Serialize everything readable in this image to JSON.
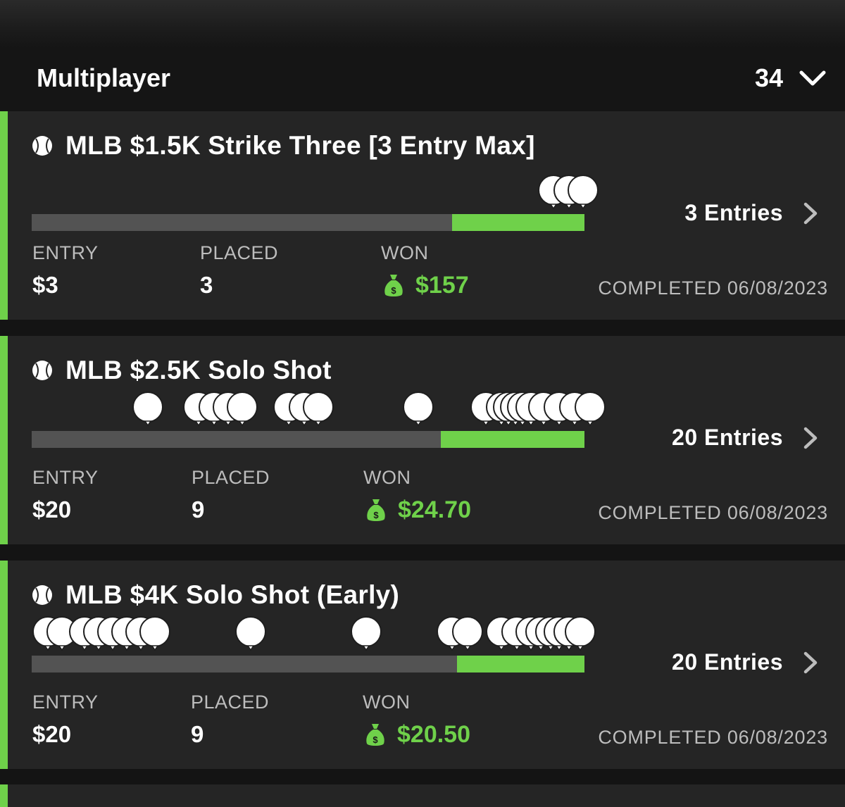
{
  "section": {
    "title": "Multiplayer",
    "count": "34"
  },
  "colors": {
    "accent": "#6fd14a",
    "background": "#141414",
    "card": "#252525",
    "track": "#535353"
  },
  "labels": {
    "entry": "ENTRY",
    "placed": "PLACED",
    "won": "WON"
  },
  "contests": [
    {
      "sport_icon": "baseball-icon",
      "title": "MLB $1.5K Strike Three [3 Entry Max]",
      "entries": "3 Entries",
      "entry": "$3",
      "placed": "3",
      "won": "$157",
      "status": "COMPLETED 06/08/2023",
      "progress_won_fraction": 0.24
    },
    {
      "sport_icon": "baseball-icon",
      "title": "MLB $2.5K Solo Shot",
      "entries": "20 Entries",
      "entry": "$20",
      "placed": "9",
      "won": "$24.70",
      "status": "COMPLETED 06/08/2023",
      "progress_won_fraction": 0.26
    },
    {
      "sport_icon": "baseball-icon",
      "title": "MLB $4K Solo Shot (Early)",
      "entries": "20 Entries",
      "entry": "$20",
      "placed": "9",
      "won": "$20.50",
      "status": "COMPLETED 06/08/2023",
      "progress_won_fraction": 0.23
    }
  ]
}
